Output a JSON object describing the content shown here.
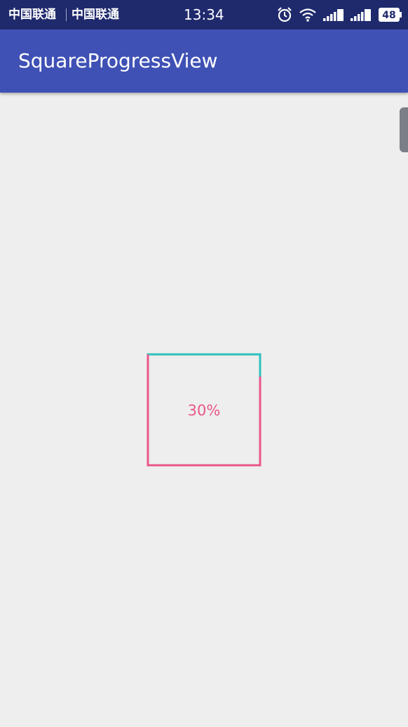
{
  "status_bar": {
    "carrier_1": "中国联通",
    "carrier_2": "中国联通",
    "time": "13:34",
    "battery": "48",
    "icons": [
      "alarm-icon",
      "wifi-icon",
      "signal-icon",
      "signal-icon",
      "battery-icon"
    ]
  },
  "app_bar": {
    "title": "SquareProgressView"
  },
  "progress": {
    "value_fraction": 0.3,
    "label": "30%",
    "progress_color": "#e8578a",
    "track_color": "#2ec0bf"
  },
  "colors": {
    "status_bar": "#1f2a6d",
    "app_bar": "#3f51b5",
    "background": "#eeeeee"
  }
}
